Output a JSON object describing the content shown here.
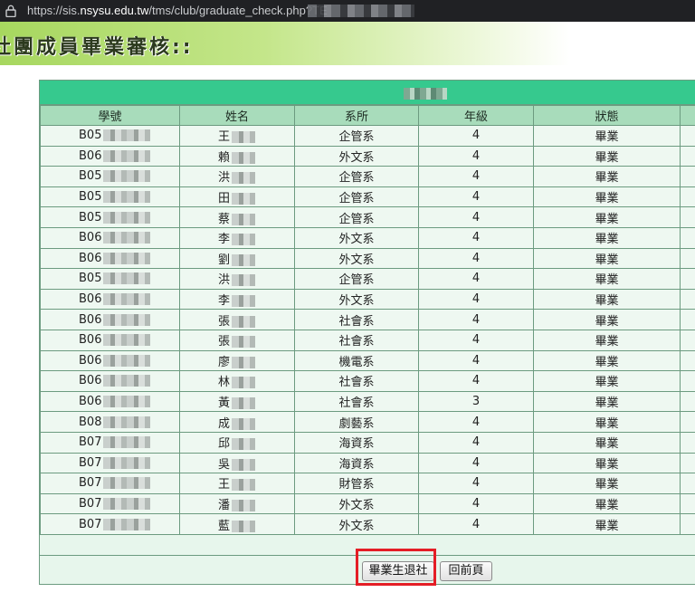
{
  "browser": {
    "url_prefix": "https://sis.",
    "url_domain": "nsysu.edu.tw",
    "url_path": "/tms/club/graduate_check.php?TE"
  },
  "page": {
    "title": "社團成員畢業審核::"
  },
  "table": {
    "columns": [
      "學號",
      "姓名",
      "系所",
      "年級",
      "狀態"
    ],
    "rows": [
      {
        "id": "B05",
        "name": "王",
        "dept": "企管系",
        "grade": "4",
        "status": "畢業"
      },
      {
        "id": "B06",
        "name": "賴",
        "dept": "外文系",
        "grade": "4",
        "status": "畢業"
      },
      {
        "id": "B05",
        "name": "洪",
        "dept": "企管系",
        "grade": "4",
        "status": "畢業"
      },
      {
        "id": "B05",
        "name": "田",
        "dept": "企管系",
        "grade": "4",
        "status": "畢業"
      },
      {
        "id": "B05",
        "name": "蔡",
        "dept": "企管系",
        "grade": "4",
        "status": "畢業"
      },
      {
        "id": "B06",
        "name": "李",
        "dept": "外文系",
        "grade": "4",
        "status": "畢業"
      },
      {
        "id": "B06",
        "name": "劉",
        "dept": "外文系",
        "grade": "4",
        "status": "畢業"
      },
      {
        "id": "B05",
        "name": "洪",
        "dept": "企管系",
        "grade": "4",
        "status": "畢業"
      },
      {
        "id": "B06",
        "name": "李",
        "dept": "外文系",
        "grade": "4",
        "status": "畢業"
      },
      {
        "id": "B06",
        "name": "張",
        "dept": "社會系",
        "grade": "4",
        "status": "畢業"
      },
      {
        "id": "B06",
        "name": "張",
        "dept": "社會系",
        "grade": "4",
        "status": "畢業"
      },
      {
        "id": "B06",
        "name": "廖",
        "dept": "機電系",
        "grade": "4",
        "status": "畢業"
      },
      {
        "id": "B06",
        "name": "林",
        "dept": "社會系",
        "grade": "4",
        "status": "畢業"
      },
      {
        "id": "B06",
        "name": "黃",
        "dept": "社會系",
        "grade": "3",
        "status": "畢業"
      },
      {
        "id": "B08",
        "name": "成",
        "dept": "劇藝系",
        "grade": "4",
        "status": "畢業"
      },
      {
        "id": "B07",
        "name": "邱",
        "dept": "海資系",
        "grade": "4",
        "status": "畢業"
      },
      {
        "id": "B07",
        "name": "吳",
        "dept": "海資系",
        "grade": "4",
        "status": "畢業"
      },
      {
        "id": "B07",
        "name": "王",
        "dept": "財管系",
        "grade": "4",
        "status": "畢業"
      },
      {
        "id": "B07",
        "name": "潘",
        "dept": "外文系",
        "grade": "4",
        "status": "畢業"
      },
      {
        "id": "B07",
        "name": "藍",
        "dept": "外文系",
        "grade": "4",
        "status": "畢業"
      }
    ]
  },
  "buttons": {
    "quit": "畢業生退社",
    "back": "回前頁"
  },
  "colors": {
    "caption_bg": "#36c98e",
    "header_bg": "#a8dcbb",
    "row_bg": "#eef8f1",
    "highlight": "#e41e26"
  }
}
